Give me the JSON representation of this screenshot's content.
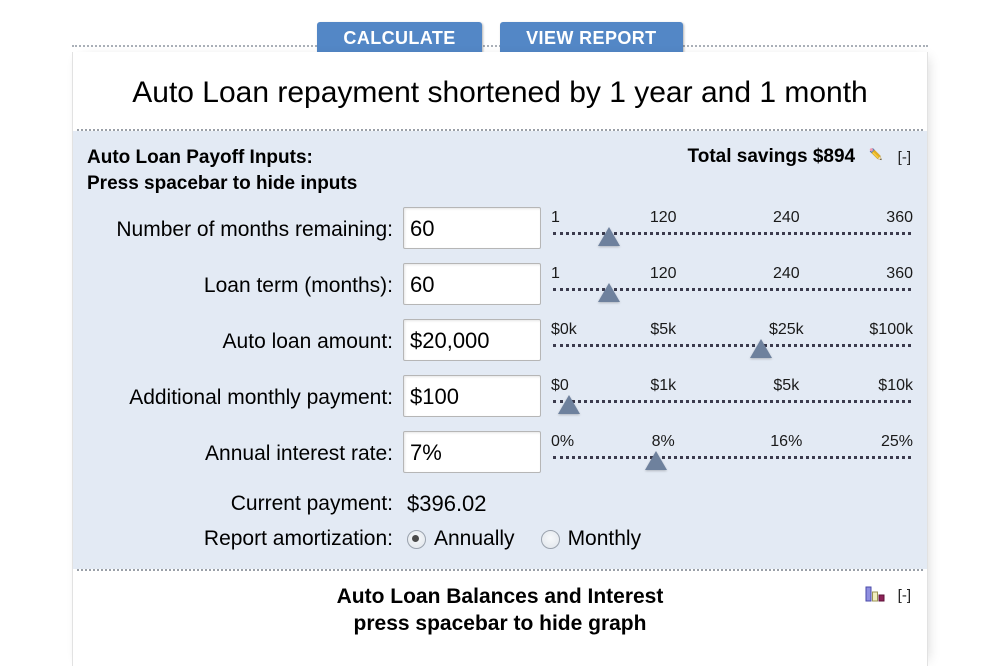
{
  "toolbar": {
    "calculate_label": "CALCULATE",
    "view_report_label": "VIEW REPORT",
    "accent_color": "#5387c6"
  },
  "page_title": "Auto Loan repayment shortened by 1 year and 1 month",
  "inputs_panel": {
    "heading_line1": "Auto Loan Payoff Inputs:",
    "heading_line2": "Press spacebar to hide inputs",
    "savings_label": "Total savings $894",
    "edit_icon": "pencil-icon",
    "collapse_label": "[-]",
    "background_color": "#e3eaf4",
    "rows": [
      {
        "label": "Number of months remaining:",
        "value": "60",
        "ticks": [
          "1",
          "120",
          "240",
          "360"
        ],
        "handle_pct": 16
      },
      {
        "label": "Loan term (months):",
        "value": "60",
        "ticks": [
          "1",
          "120",
          "240",
          "360"
        ],
        "handle_pct": 16
      },
      {
        "label": "Auto loan amount:",
        "value": "$20,000",
        "ticks": [
          "$0k",
          "$5k",
          "$25k",
          "$100k"
        ],
        "handle_pct": 58
      },
      {
        "label": "Additional monthly payment:",
        "value": "$100",
        "ticks": [
          "$0",
          "$1k",
          "$5k",
          "$10k"
        ],
        "handle_pct": 5
      },
      {
        "label": "Annual interest rate:",
        "value": "7%",
        "ticks": [
          "0%",
          "8%",
          "16%",
          "25%"
        ],
        "handle_pct": 29
      }
    ],
    "current_payment": {
      "label": "Current payment:",
      "value": "$396.02"
    },
    "amortization": {
      "label": "Report amortization:",
      "options": [
        {
          "label": "Annually",
          "selected": true
        },
        {
          "label": "Monthly",
          "selected": false
        }
      ]
    }
  },
  "graph_section": {
    "title_line1": "Auto Loan Balances and Interest",
    "title_line2": "press spacebar to hide graph",
    "chart_icon": "bar-chart-icon",
    "collapse_label": "[-]"
  }
}
